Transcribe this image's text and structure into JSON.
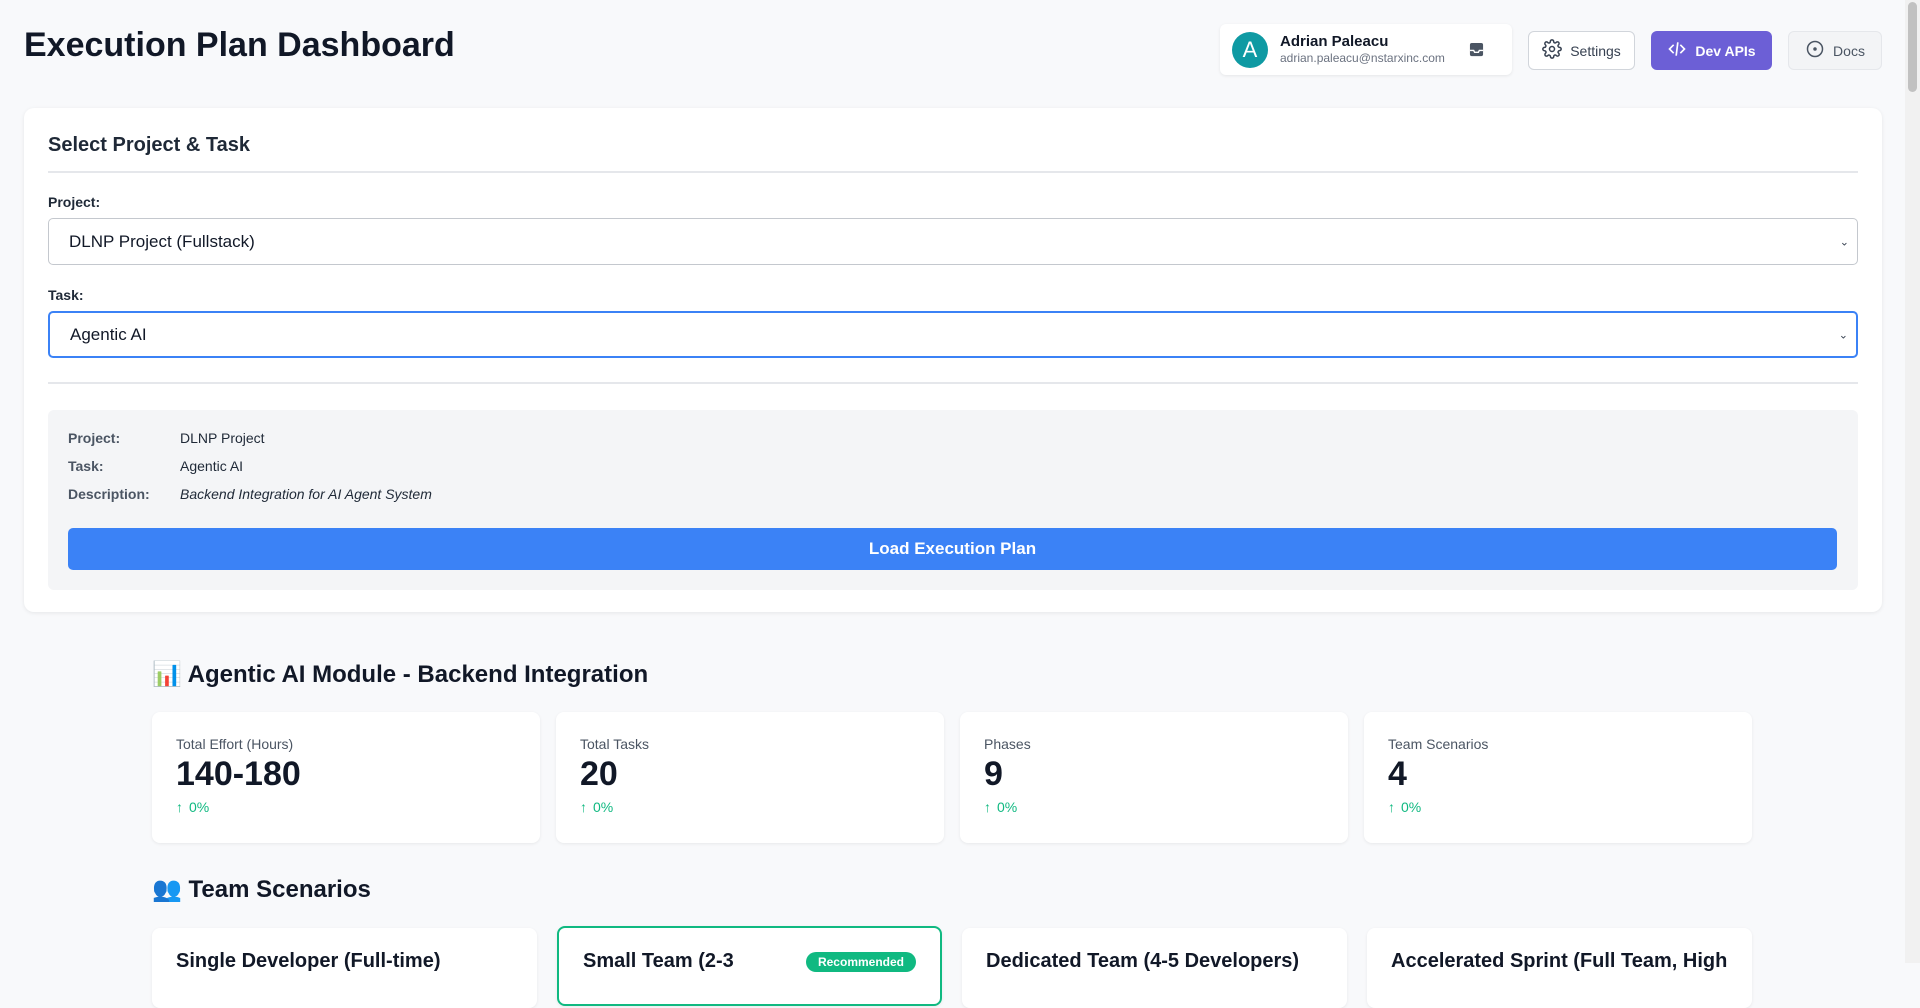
{
  "header": {
    "title": "Execution Plan Dashboard",
    "user": {
      "initial": "A",
      "name": "Adrian Paleacu",
      "email": "adrian.paleacu@nstarxinc.com"
    },
    "buttons": {
      "settings": "Settings",
      "dev_apis": "Dev APIs",
      "docs": "Docs"
    }
  },
  "select_card": {
    "title": "Select Project & Task",
    "project_label": "Project:",
    "project_value": "DLNP Project (Fullstack)",
    "task_label": "Task:",
    "task_value": "Agentic AI",
    "info": {
      "project_key": "Project:",
      "project_val": "DLNP Project",
      "task_key": "Task:",
      "task_val": "Agentic AI",
      "desc_key": "Description:",
      "desc_val": "Backend Integration for AI Agent System"
    },
    "load_button": "Load Execution Plan"
  },
  "module": {
    "title": "📊 Agentic AI Module - Backend Integration",
    "stats": [
      {
        "label": "Total Effort (Hours)",
        "value": "140-180",
        "change": "0%"
      },
      {
        "label": "Total Tasks",
        "value": "20",
        "change": "0%"
      },
      {
        "label": "Phases",
        "value": "9",
        "change": "0%"
      },
      {
        "label": "Team Scenarios",
        "value": "4",
        "change": "0%"
      }
    ]
  },
  "team": {
    "title": "👥 Team Scenarios",
    "scenarios": [
      {
        "name": "Single Developer (Full-time)"
      },
      {
        "name": "Small Team (2-3",
        "badge": "Recommended"
      },
      {
        "name": "Dedicated Team (4-5 Developers)"
      },
      {
        "name": "Accelerated Sprint (Full Team, High"
      }
    ]
  },
  "colors": {
    "primary": "#3b82f6",
    "dev_apis": "#6c5fd6",
    "success": "#10b981",
    "avatar": "#0f9aa3"
  }
}
